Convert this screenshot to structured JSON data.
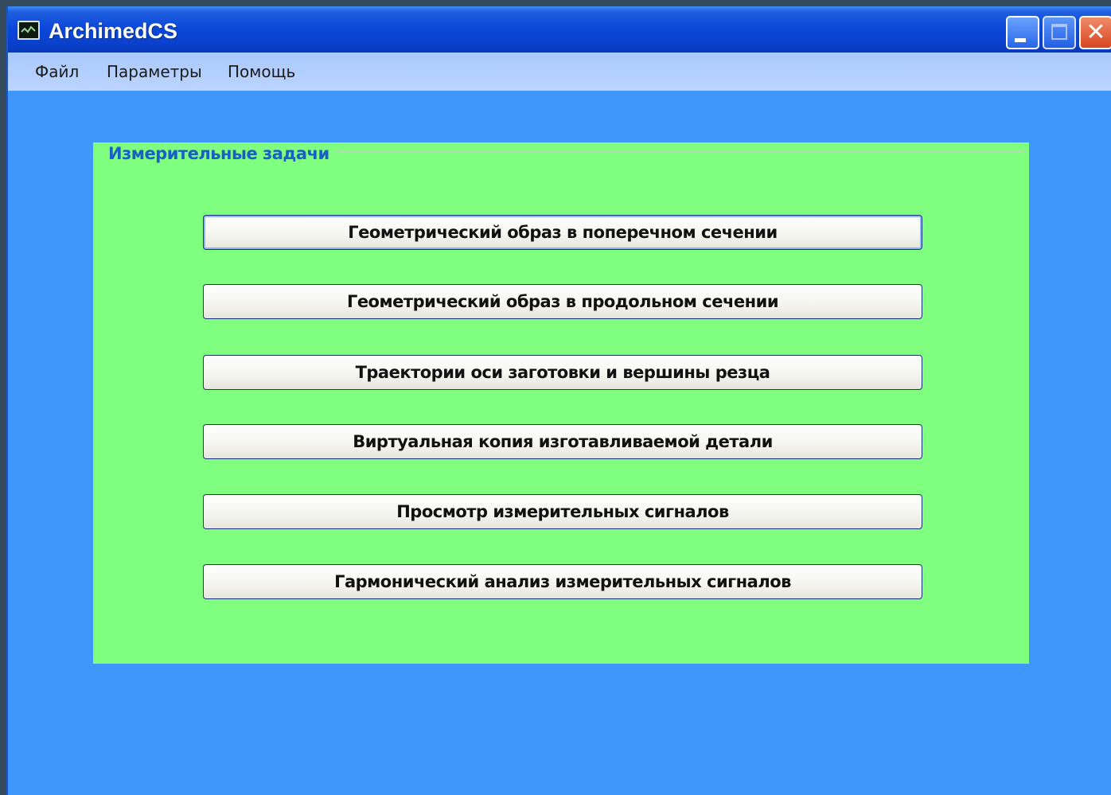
{
  "window": {
    "title": "ArchimedCS",
    "buttons": {
      "minimize": "minimize-icon",
      "maximize": "maximize-icon",
      "close": "close-icon"
    }
  },
  "menu": {
    "items": [
      "Файл",
      "Параметры",
      "Помощь"
    ]
  },
  "group": {
    "title": "Измерительные задачи",
    "buttons": [
      "Геометрический образ в поперечном сечении",
      "Геометрический образ в продольном сечении",
      "Траектории оси заготовки и вершины резца",
      "Виртуальная копия изготавливаемой детали",
      "Просмотр измерительных сигналов",
      "Гармонический анализ измерительных сигналов"
    ]
  },
  "colors": {
    "window_bg": "#3f97fb",
    "group_bg": "#80fe80",
    "group_title": "#1a5ec8",
    "titlebar": "#0a46d8"
  }
}
